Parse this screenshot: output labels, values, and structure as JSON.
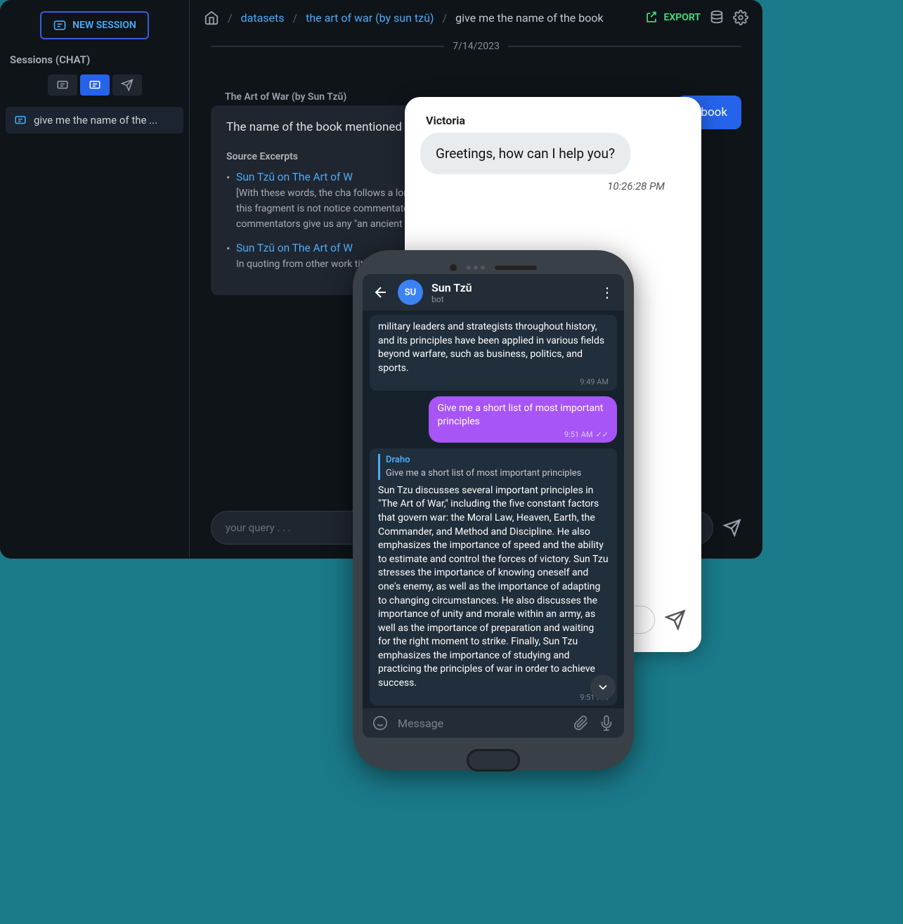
{
  "sidebar": {
    "new_session_label": "NEW SESSION",
    "heading": "Sessions (CHAT)",
    "session_label": "give me the name of the ..."
  },
  "breadcrumbs": {
    "datasets": "datasets",
    "book": "the art of war (by sun tzŭ)",
    "current": "give me the name of the book"
  },
  "topbar": {
    "export": "EXPORT"
  },
  "content": {
    "date": "7/14/2023",
    "user_chip": "e book",
    "reply_title": "The Art of War (by Sun Tzŭ)",
    "reply_body": "The name of the book mentioned in Tzŭ.",
    "excerpts_head": "Source Excerpts",
    "excerpt1_link": "Sun Tzŭ on The Art of W",
    "excerpt1_body": "[With these words, the cha follows a long appendix in now lost, but apparently ex this fragment is not notice commentator raises a dou Management says: [It is pe commentators give us any \"an ancient military classic",
    "excerpt2_link": "Sun Tzŭ on The Art of W",
    "excerpt2_body": "In quoting from other work title by way of reference, a",
    "query_placeholder": "your query . . ."
  },
  "victoria": {
    "name": "Victoria",
    "greeting": "Greetings, how can I help you?",
    "time": "10:26:28 PM"
  },
  "phone": {
    "avatar_initials": "SU",
    "title": "Sun Tzŭ",
    "sub": "bot",
    "msg1_body": "military leaders and strategists throughout history, and its principles have been applied in various fields beyond warfare, such as business, politics, and sports.",
    "msg1_time": "9:49 AM",
    "user_msg": "Give me a short list of most important principles",
    "user_time": "9:51 AM",
    "quote_name": "Draho",
    "quote_text": "Give me a short list of most important principles",
    "msg2_body": "Sun Tzu discusses several important principles in \"The Art of War,\" including the five constant factors that govern war: the Moral Law, Heaven, Earth, the Commander, and Method and Discipline. He also emphasizes the importance of speed and the ability to estimate and control the forces of victory. Sun Tzu stresses the importance of knowing oneself and one's enemy, as well as the importance of adapting to changing circumstances. He also discusses the importance of unity and morale within an army, as well as the importance of preparation and waiting for the right moment to strike. Finally, Sun Tzu emphasizes the importance of studying and practicing the principles of war in order to achieve success.",
    "msg2_time": "9:51 AM",
    "footer_placeholder": "Message"
  }
}
